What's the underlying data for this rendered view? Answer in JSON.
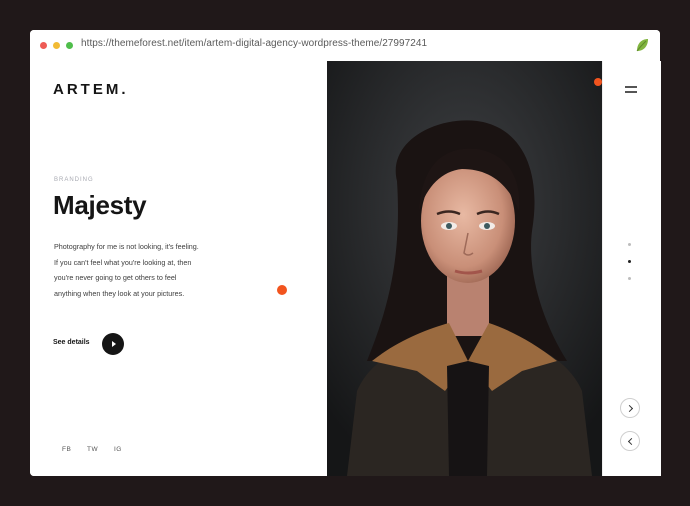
{
  "browser": {
    "url": "https://themeforest.net/item/artem-digital-agency-wordpress-theme/27997241"
  },
  "site": {
    "logo": "ARTEM."
  },
  "slide": {
    "category": "BRANDING",
    "title": "Majesty",
    "description": "Photography for me is not looking, it's feeling. If you can't feel what you're looking at, then you're never going to get others to feel anything when they look at your pictures.",
    "cta_label": "See details"
  },
  "social": [
    "FB",
    "TW",
    "IG"
  ],
  "pager": {
    "active_index": 1
  },
  "colors": {
    "accent": "#f2541e",
    "backdrop": "#201819",
    "text": "#151515"
  },
  "icons": {
    "menu": "menu-icon",
    "play": "play-icon",
    "next": "chevron-right-icon",
    "prev": "chevron-left-icon",
    "brand": "leaf-icon"
  }
}
